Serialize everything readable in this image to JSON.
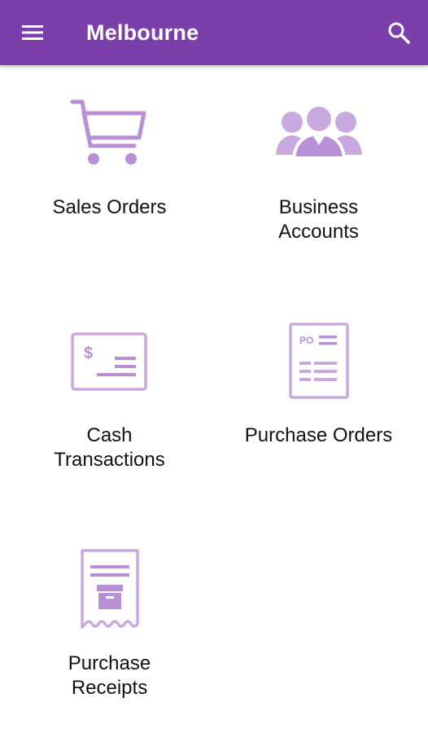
{
  "appbar": {
    "title": "Melbourne",
    "background_color": "#7b3fab",
    "menu_icon": "hamburger-menu-icon",
    "search_icon": "search-icon"
  },
  "theme": {
    "icon_color": "#b98fd6",
    "icon_light_color": "#c9a9e0",
    "label_color": "#111111"
  },
  "tiles": [
    {
      "label": "Sales Orders",
      "icon": "shopping-cart-icon"
    },
    {
      "label": "Business\nAccounts",
      "icon": "people-group-icon"
    },
    {
      "label": "Cash\nTransactions",
      "icon": "cash-check-icon"
    },
    {
      "label": "Purchase Orders",
      "icon": "purchase-order-document-icon",
      "icon_text": "PO"
    },
    {
      "label": "Purchase\nReceipts",
      "icon": "receipt-box-icon"
    }
  ]
}
